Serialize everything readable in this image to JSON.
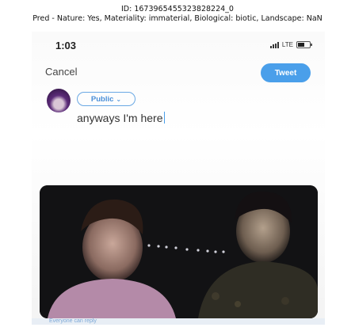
{
  "caption": {
    "line1": "ID: 1673965455323828224_0",
    "line2": "Pred - Nature: Yes, Materiality: immaterial, Biological: biotic, Landscape: NaN"
  },
  "status_bar": {
    "time": "1:03",
    "network": "LTE"
  },
  "composer": {
    "cancel_label": "Cancel",
    "tweet_label": "Tweet",
    "audience_label": "Public",
    "text": "anyways I'm here",
    "reply_setting": "Everyone can reply"
  },
  "colors": {
    "accent": "#4a9fea"
  }
}
